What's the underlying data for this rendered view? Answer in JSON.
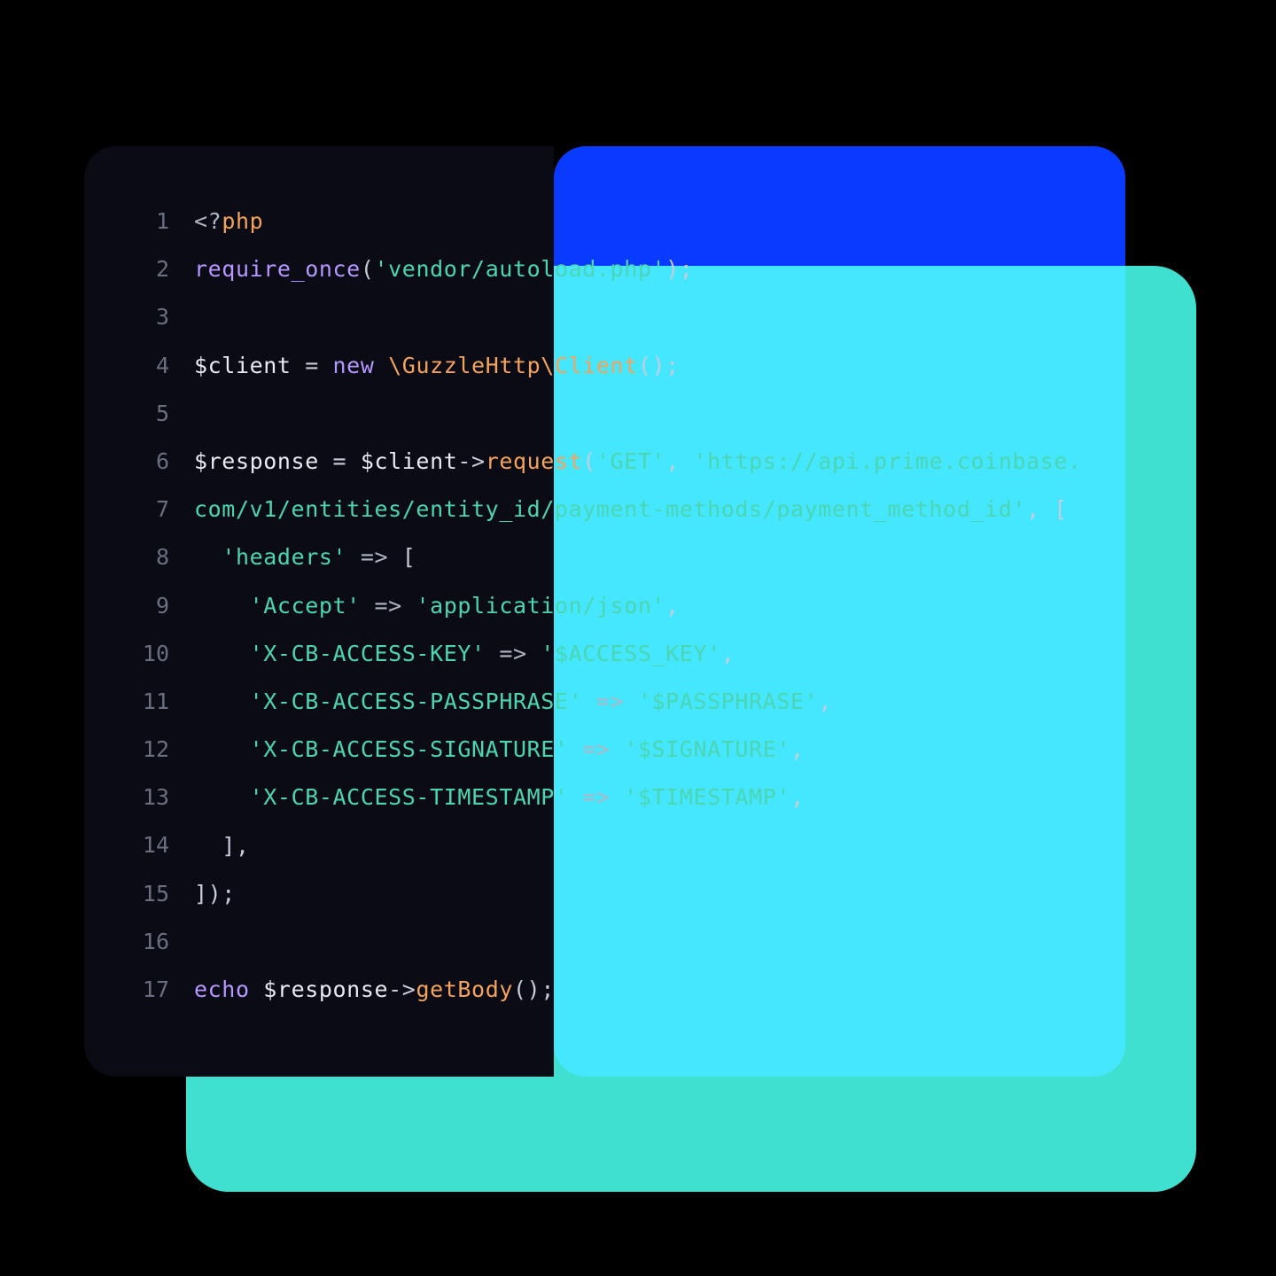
{
  "language": "php",
  "colors": {
    "background": "#000000",
    "teal_card": "#3FE0D0",
    "blue_card": "#0a3bff",
    "code_bg_left": "#0a0b14",
    "gutter": "#6a6f80",
    "keyword": "#b696ff",
    "function": "#f5a35c",
    "string": "#4bd6b1",
    "default": "#e8eaf0"
  },
  "line_numbers": [
    "1",
    "2",
    "3",
    "4",
    "5",
    "6",
    "7",
    "8",
    "9",
    "10",
    "11",
    "12",
    "13",
    "14",
    "15",
    "16",
    "17"
  ],
  "code_lines": [
    {
      "tokens": [
        {
          "cls": "c-delim",
          "t": "<?"
        },
        {
          "cls": "c-fn",
          "t": "php"
        }
      ]
    },
    {
      "tokens": [
        {
          "cls": "c-kw",
          "t": "require_once"
        },
        {
          "cls": "c-punct",
          "t": "("
        },
        {
          "cls": "c-str",
          "t": "'vendor/autoload.php'"
        },
        {
          "cls": "c-punct",
          "t": ");"
        }
      ]
    },
    {
      "tokens": []
    },
    {
      "tokens": [
        {
          "cls": "c-var",
          "t": "$client "
        },
        {
          "cls": "c-punct",
          "t": "= "
        },
        {
          "cls": "c-kw",
          "t": "new "
        },
        {
          "cls": "c-class",
          "t": "\\GuzzleHttp\\Client"
        },
        {
          "cls": "c-punct",
          "t": "();"
        }
      ]
    },
    {
      "tokens": []
    },
    {
      "tokens": [
        {
          "cls": "c-var",
          "t": "$response "
        },
        {
          "cls": "c-punct",
          "t": "= "
        },
        {
          "cls": "c-var",
          "t": "$client"
        },
        {
          "cls": "c-punct",
          "t": "->"
        },
        {
          "cls": "c-fn",
          "t": "request"
        },
        {
          "cls": "c-punct",
          "t": "("
        },
        {
          "cls": "c-str",
          "t": "'GET'"
        },
        {
          "cls": "c-punct",
          "t": ", "
        },
        {
          "cls": "c-str",
          "t": "'https://api.prime.coinbase.com/v1/entities/entity_id/payment-methods/payment_method_id'"
        },
        {
          "cls": "c-punct",
          "t": ", ["
        }
      ]
    },
    {
      "tokens": [
        {
          "cls": "c-var",
          "t": "  "
        },
        {
          "cls": "c-str",
          "t": "'headers'"
        },
        {
          "cls": "c-arrow",
          "t": " => "
        },
        {
          "cls": "c-punct",
          "t": "["
        }
      ]
    },
    {
      "tokens": [
        {
          "cls": "c-var",
          "t": "    "
        },
        {
          "cls": "c-str",
          "t": "'Accept'"
        },
        {
          "cls": "c-arrow",
          "t": " => "
        },
        {
          "cls": "c-str",
          "t": "'application/json'"
        },
        {
          "cls": "c-punct",
          "t": ","
        }
      ]
    },
    {
      "tokens": [
        {
          "cls": "c-var",
          "t": "    "
        },
        {
          "cls": "c-str",
          "t": "'X-CB-ACCESS-KEY'"
        },
        {
          "cls": "c-arrow",
          "t": " => "
        },
        {
          "cls": "c-str",
          "t": "'$ACCESS_KEY'"
        },
        {
          "cls": "c-punct",
          "t": ","
        }
      ]
    },
    {
      "tokens": [
        {
          "cls": "c-var",
          "t": "    "
        },
        {
          "cls": "c-str",
          "t": "'X-CB-ACCESS-PASSPHRASE'"
        },
        {
          "cls": "c-arrow",
          "t": " => "
        },
        {
          "cls": "c-str",
          "t": "'$PASSPHRASE'"
        },
        {
          "cls": "c-punct",
          "t": ","
        }
      ]
    },
    {
      "tokens": [
        {
          "cls": "c-var",
          "t": "    "
        },
        {
          "cls": "c-str",
          "t": "'X-CB-ACCESS-SIGNATURE'"
        },
        {
          "cls": "c-arrow",
          "t": " => "
        },
        {
          "cls": "c-str",
          "t": "'$SIGNATURE'"
        },
        {
          "cls": "c-punct",
          "t": ","
        }
      ]
    },
    {
      "tokens": [
        {
          "cls": "c-var",
          "t": "    "
        },
        {
          "cls": "c-str",
          "t": "'X-CB-ACCESS-TIMESTAMP'"
        },
        {
          "cls": "c-arrow",
          "t": " => "
        },
        {
          "cls": "c-str",
          "t": "'$TIMESTAMP'"
        },
        {
          "cls": "c-punct",
          "t": ","
        }
      ]
    },
    {
      "tokens": [
        {
          "cls": "c-var",
          "t": "  "
        },
        {
          "cls": "c-punct",
          "t": "],"
        }
      ]
    },
    {
      "tokens": [
        {
          "cls": "c-punct",
          "t": "]);"
        }
      ]
    },
    {
      "tokens": []
    },
    {
      "tokens": [
        {
          "cls": "c-kw",
          "t": "echo "
        },
        {
          "cls": "c-var",
          "t": "$response"
        },
        {
          "cls": "c-punct",
          "t": "->"
        },
        {
          "cls": "c-fn",
          "t": "getBody"
        },
        {
          "cls": "c-punct",
          "t": "();"
        }
      ]
    }
  ]
}
